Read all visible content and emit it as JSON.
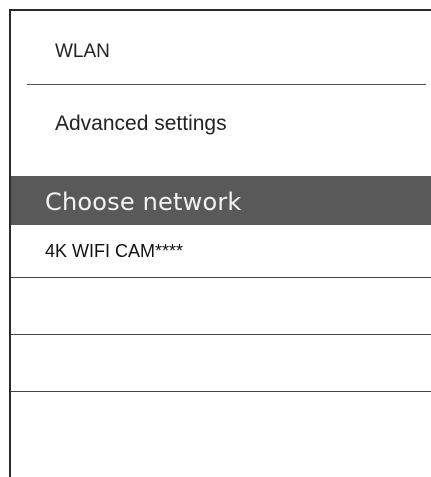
{
  "wifi_menu": {
    "wlan_label": "WLAN",
    "advanced_label": "Advanced settings"
  },
  "network_section": {
    "title": "Choose network",
    "networks": [
      {
        "name": "4K WIFI CAM****"
      },
      {
        "name": ""
      },
      {
        "name": ""
      }
    ]
  },
  "colors": {
    "header_background": "#595959",
    "header_text": "#f2f2f2",
    "divider": "#555555"
  }
}
